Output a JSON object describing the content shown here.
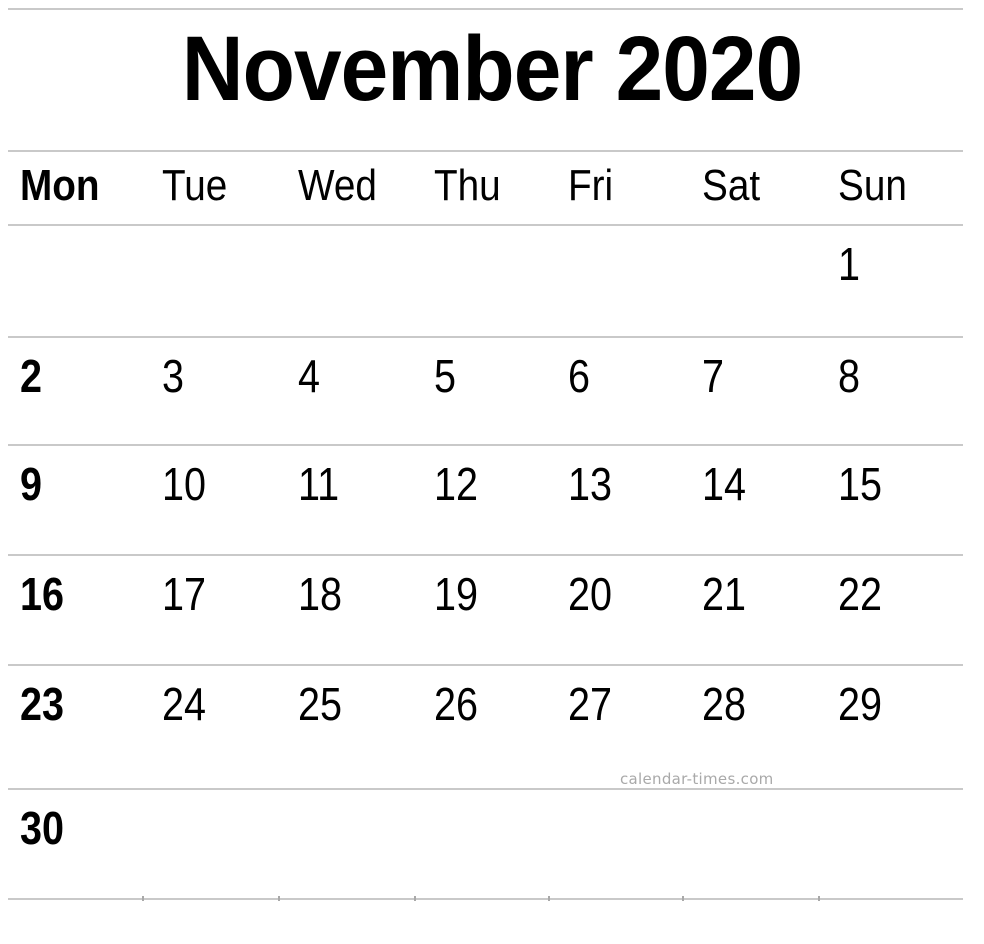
{
  "title": "November 2020",
  "month": "November",
  "year": "2020",
  "weekday_headers": [
    {
      "label": "Mon",
      "bold": true
    },
    {
      "label": "Tue",
      "bold": false
    },
    {
      "label": "Wed",
      "bold": false
    },
    {
      "label": "Thu",
      "bold": false
    },
    {
      "label": "Fri",
      "bold": false
    },
    {
      "label": "Sat",
      "bold": false
    },
    {
      "label": "Sun",
      "bold": false
    }
  ],
  "weeks": [
    {
      "days": [
        "",
        "",
        "",
        "",
        "",
        "",
        "1"
      ]
    },
    {
      "days": [
        "2",
        "3",
        "4",
        "5",
        "6",
        "7",
        "8"
      ]
    },
    {
      "days": [
        "9",
        "10",
        "11",
        "12",
        "13",
        "14",
        "15"
      ]
    },
    {
      "days": [
        "16",
        "17",
        "18",
        "19",
        "20",
        "21",
        "22"
      ]
    },
    {
      "days": [
        "23",
        "24",
        "25",
        "26",
        "27",
        "28",
        "29"
      ]
    },
    {
      "days": [
        "30",
        "",
        "",
        "",
        "",
        "",
        ""
      ]
    }
  ],
  "watermark": "calendar-times.com",
  "colors": {
    "text": "#000000",
    "rule": "#c9c9c9",
    "watermark": "#a9a9a9",
    "background": "#ffffff"
  }
}
